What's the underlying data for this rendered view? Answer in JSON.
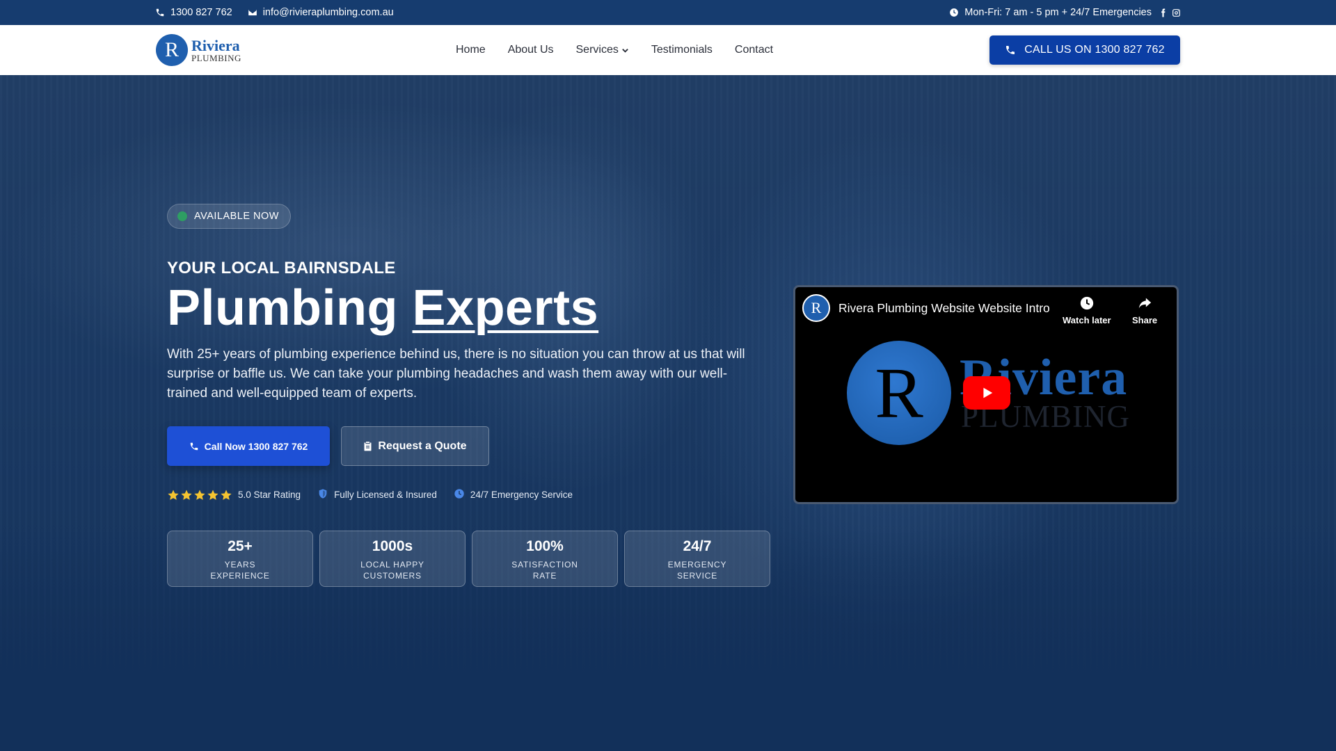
{
  "topbar": {
    "phone": "1300 827 762",
    "email": "info@rivieraplumbing.com.au",
    "hours": "Mon-Fri: 7 am - 5 pm + 24/7 Emergencies"
  },
  "logo": {
    "mark": "R",
    "line1": "Riviera",
    "line2": "PLUMBING"
  },
  "nav": {
    "items": [
      {
        "label": "Home"
      },
      {
        "label": "About Us"
      },
      {
        "label": "Services"
      },
      {
        "label": "Testimonials"
      },
      {
        "label": "Contact"
      }
    ],
    "cta": "CALL US ON 1300 827 762"
  },
  "hero": {
    "badge": "AVAILABLE NOW",
    "kicker": "YOUR LOCAL BAIRNSDALE",
    "headline_plain": "Plumbing",
    "headline_underlined": "Experts",
    "lead": "With 25+ years of plumbing experience behind us, there is no situation you can throw at us that will surprise or baffle us. We can take your plumbing headaches and wash them away with our well-trained and well-equipped team of experts.",
    "btn_primary": "Call Now 1300 827 762",
    "btn_secondary": "Request a Quote",
    "trust": {
      "rating": "5.0 Star Rating",
      "stars": 5,
      "licensed": "Fully Licensed & Insured",
      "emergency": "24/7 Emergency Service"
    },
    "stats": [
      {
        "num": "25+",
        "line1": "YEARS",
        "line2": "EXPERIENCE"
      },
      {
        "num": "1000s",
        "line1": "LOCAL HAPPY",
        "line2": "CUSTOMERS"
      },
      {
        "num": "100%",
        "line1": "SATISFACTION",
        "line2": "RATE"
      },
      {
        "num": "24/7",
        "line1": "EMERGENCY",
        "line2": "SERVICE"
      }
    ]
  },
  "video": {
    "title": "Rivera Plumbing Website Website Intro",
    "avatar": "R",
    "watch_later": "Watch later",
    "share": "Share",
    "logo_mark": "R",
    "logo_word1": "Riviera",
    "logo_word2": "PLUMBING"
  },
  "colors": {
    "topbar": "#163c6f",
    "brand_blue": "#0b3ea5",
    "primary_button": "#1e50d6",
    "available_dot": "#2e9e63",
    "star": "#f5c431",
    "youtube_red": "#ff0000"
  }
}
